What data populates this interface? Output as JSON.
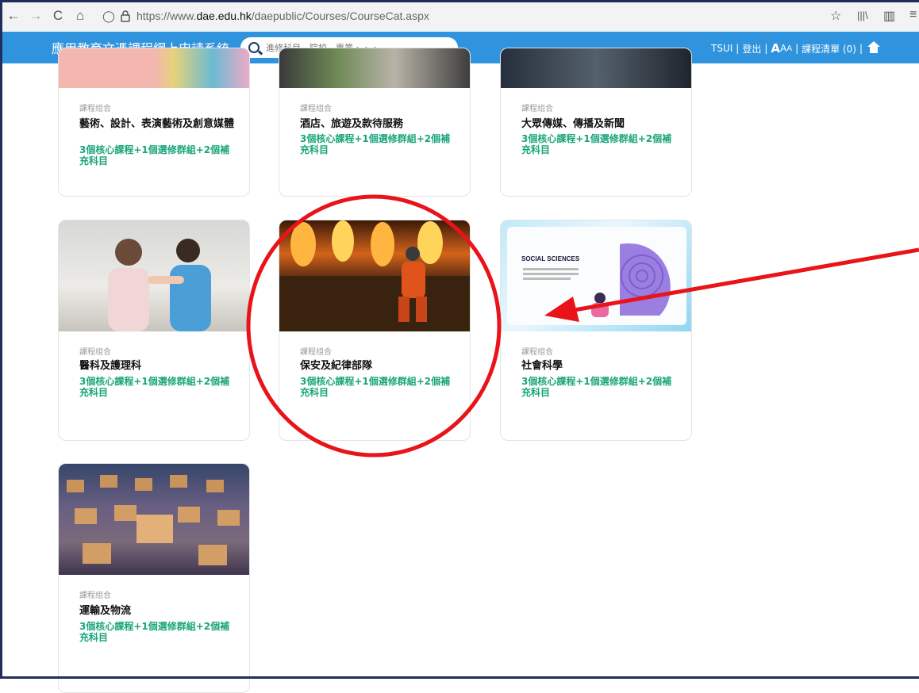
{
  "browser": {
    "url_prefix": "https://www.",
    "url_domain": "dae.edu.hk",
    "url_path": "/daepublic/Courses/CourseCat.aspx"
  },
  "header": {
    "title": "應用教育文憑課程網上申請系統",
    "search_placeholder": "進修科目、院校、專業・・・",
    "user": "TSUI",
    "logout": "登出",
    "font_large": "A",
    "font_medium": "A",
    "font_small": "A",
    "course_list": "課程清單 (0)",
    "separator": "|"
  },
  "cards": [
    {
      "category": "課程组合",
      "title": "藝術、設計、表演藝術及創意媒體",
      "subtitle": "3個核心課程+1個選修群組+2個補充科目"
    },
    {
      "category": "課程组合",
      "title": "酒店、旅遊及款待服務",
      "subtitle": "3個核心課程+1個選修群組+2個補充科目"
    },
    {
      "category": "課程组合",
      "title": "大眾傳媒、傳播及新聞",
      "subtitle": "3個核心課程+1個選修群組+2個補充科目"
    },
    {
      "category": "課程组合",
      "title": "醫科及護理科",
      "subtitle": "3個核心課程+1個選修群組+2個補充科目"
    },
    {
      "category": "課程组合",
      "title": "保安及紀律部隊",
      "subtitle": "3個核心課程+1個選修群組+2個補充科目"
    },
    {
      "category": "課程组合",
      "title": "社會科學",
      "subtitle": "3個核心課程+1個選修群組+2個補充科目",
      "image_caption": "SOCIAL SCIENCES"
    },
    {
      "category": "課程组合",
      "title": "運輸及物流",
      "subtitle": "3個核心課程+1個選修群組+2個補充科目"
    }
  ],
  "icons": {
    "back": "←",
    "forward": "→",
    "reload": "C",
    "home": "⌂",
    "shield": "◯",
    "lock": "🔒",
    "star": "☆",
    "library": "|||\\",
    "sidebar": "▥",
    "menu": "≡"
  },
  "colors": {
    "header_bg": "#2f93dd",
    "accent_green": "#1aa57a",
    "annotation_red": "#e8141a"
  }
}
